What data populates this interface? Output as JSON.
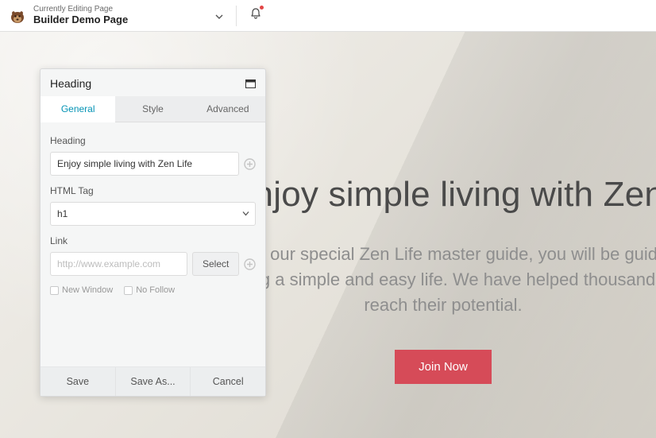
{
  "topbar": {
    "editing_label": "Currently Editing Page",
    "page_title": "Builder Demo Page"
  },
  "hero": {
    "heading": "Enjoy simple living with Zen Life",
    "sub_line1": "With our special Zen Life master guide, you will be guided into",
    "sub_line2": "living a simple and easy life. We have helped thousands",
    "sub_line3": "reach their potential.",
    "cta_label": "Join Now"
  },
  "panel": {
    "title": "Heading",
    "tabs": {
      "general": "General",
      "style": "Style",
      "advanced": "Advanced"
    },
    "fields": {
      "heading_label": "Heading",
      "heading_value": "Enjoy simple living with Zen Life",
      "html_tag_label": "HTML Tag",
      "html_tag_value": "h1",
      "link_label": "Link",
      "link_placeholder": "http://www.example.com",
      "select_btn": "Select",
      "new_window": "New Window",
      "no_follow": "No Follow"
    },
    "footer": {
      "save": "Save",
      "save_as": "Save As...",
      "cancel": "Cancel"
    }
  }
}
